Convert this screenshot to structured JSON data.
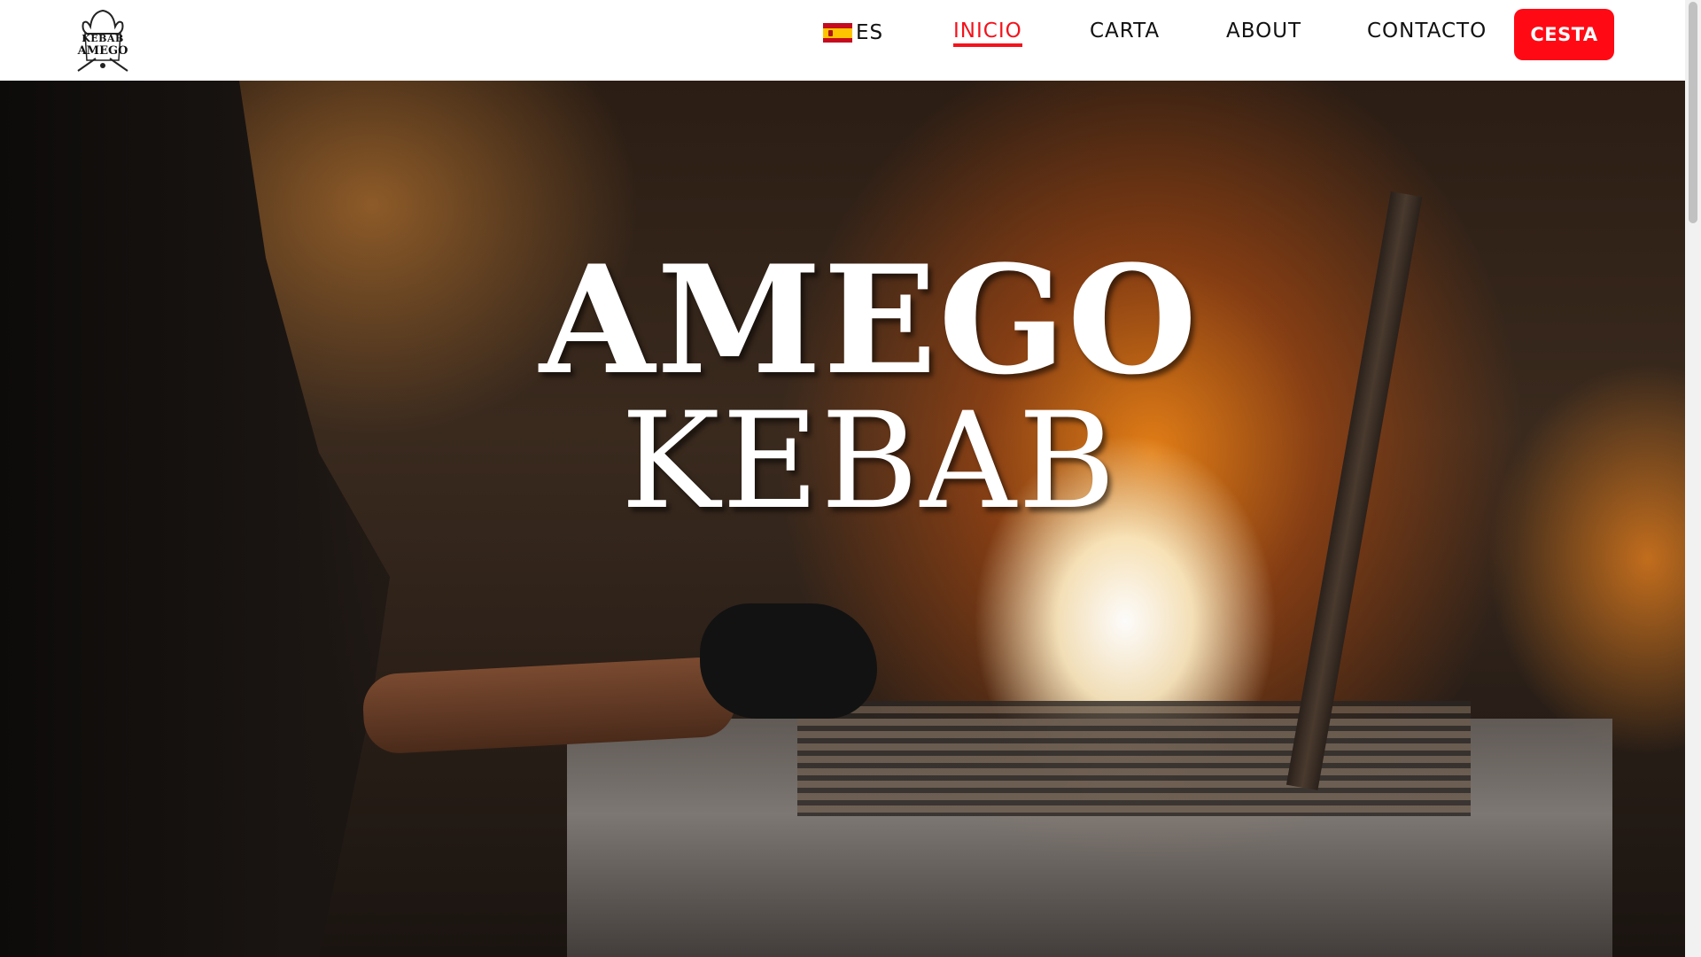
{
  "header": {
    "logo": {
      "line1": "KEBAB",
      "line2": "AMEGO"
    },
    "language": {
      "flag_icon": "spain-flag-icon",
      "label": "ES"
    },
    "nav": [
      {
        "label": "INICIO",
        "active": true
      },
      {
        "label": "CARTA",
        "active": false
      },
      {
        "label": "ABOUT",
        "active": false
      },
      {
        "label": "CONTACTO",
        "active": false
      }
    ],
    "cart_label": "CESTA"
  },
  "hero": {
    "title": "AMEGO",
    "subtitle": "KEBAB"
  },
  "colors": {
    "accent": "#ff0a14",
    "active_link": "#f4121c",
    "header_bg": "#ffffff",
    "hero_text": "#ffffff"
  }
}
